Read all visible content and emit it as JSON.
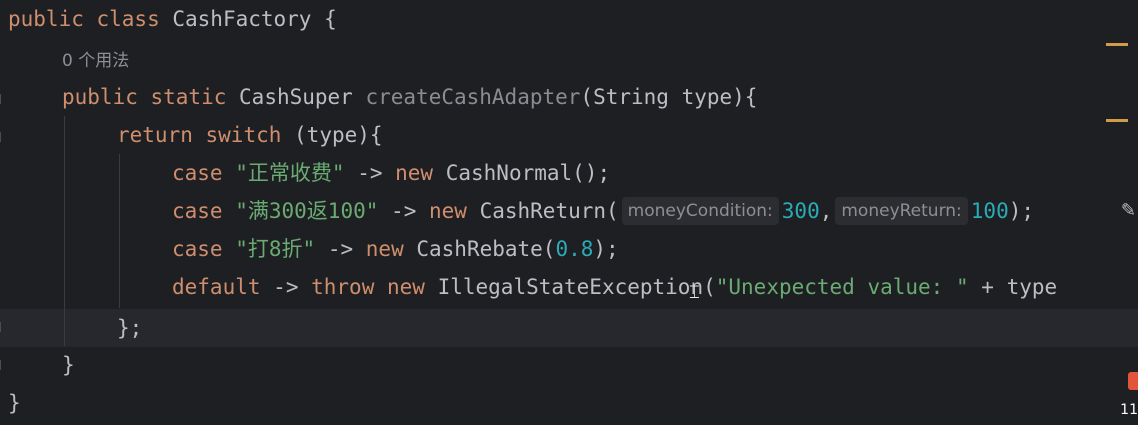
{
  "code": {
    "l1": {
      "kw": "public class",
      "name": "CashFactory",
      "brace": "{"
    },
    "usage": "0 个用法",
    "l3": {
      "kw": "public static",
      "type": "CashSuper",
      "method": "createCashAdapter",
      "params": "(String type){"
    },
    "l4": {
      "kw1": "return",
      "kw2": "switch",
      "rest": "(type){"
    },
    "l5": {
      "kw": "case",
      "str": "\"正常收费\"",
      "arrow": "->",
      "new": "new",
      "cls": "CashNormal();"
    },
    "l6": {
      "kw": "case",
      "str": "\"满300返100\"",
      "arrow": "->",
      "new": "new",
      "cls": "CashReturn(",
      "hint1": "moneyCondition:",
      "n1": "300",
      "comma": ",",
      "hint2": "moneyReturn:",
      "n2": "100",
      "end": ");"
    },
    "l7": {
      "kw": "case",
      "str": "\"打8折\"",
      "arrow": "->",
      "new": "new",
      "cls": "CashRebate(",
      "n": "0.8",
      "end": ");"
    },
    "l8": {
      "kw": "default",
      "arrow": "->",
      "throw": "throw",
      "new": "new",
      "cls": "IllegalStateException(",
      "str": "\"Unexpected value: \"",
      "rest": "+ type"
    },
    "l9": {
      "text": "};"
    },
    "l10": {
      "text": "}"
    },
    "l11": {
      "text": "}"
    }
  },
  "status": {
    "clock_fragment": "11"
  },
  "colors": {
    "background": "#1e1f22",
    "keyword": "#cf8e6d",
    "string": "#6aab73",
    "number": "#2aacb8",
    "marker": "#d29b47"
  }
}
